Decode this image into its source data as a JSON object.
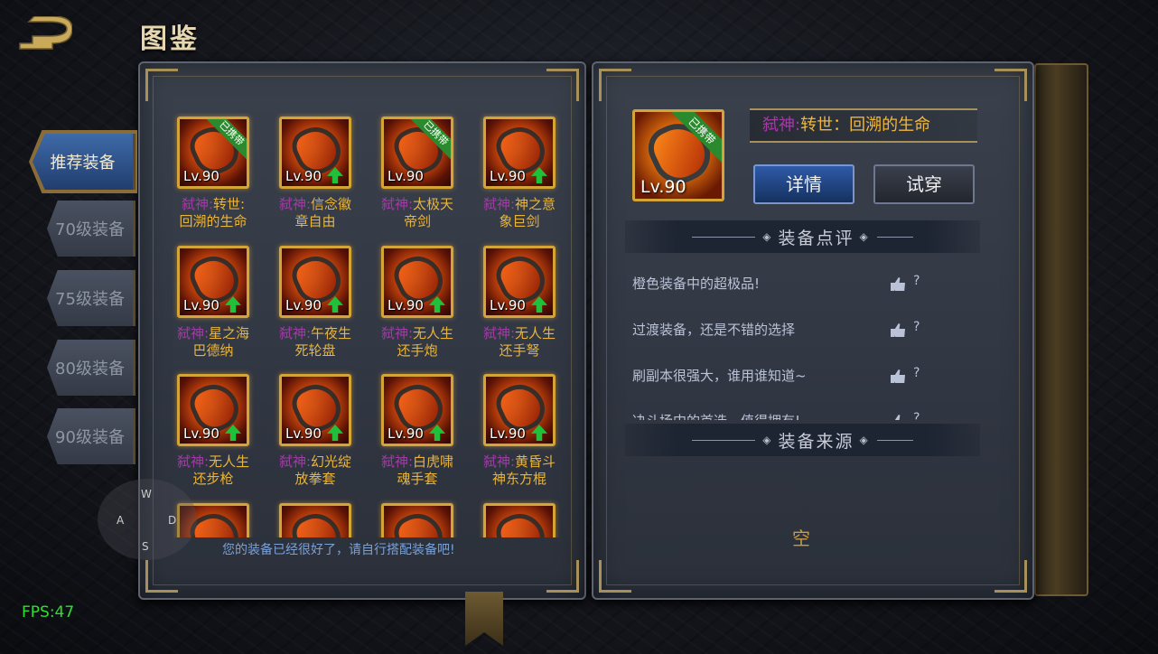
{
  "header": {
    "title": "图鉴"
  },
  "tabs": [
    {
      "label": "推荐装备",
      "active": true
    },
    {
      "label": "70级装备",
      "active": false
    },
    {
      "label": "75级装备",
      "active": false
    },
    {
      "label": "80级装备",
      "active": false
    },
    {
      "label": "90级装备",
      "active": false
    }
  ],
  "items": [
    {
      "prefix": "弑神:",
      "name1": "转世:",
      "name2": "回溯的生命",
      "lv": "Lv.90",
      "equipped": true,
      "upgrade": false
    },
    {
      "prefix": "弑神:",
      "name1": "信念徽",
      "name2": "章自由",
      "lv": "Lv.90",
      "equipped": false,
      "upgrade": true
    },
    {
      "prefix": "弑神:",
      "name1": "太极天",
      "name2": "帝剑",
      "lv": "Lv.90",
      "equipped": true,
      "upgrade": false
    },
    {
      "prefix": "弑神:",
      "name1": "神之意",
      "name2": "象巨剑",
      "lv": "Lv.90",
      "equipped": false,
      "upgrade": true
    },
    {
      "prefix": "弑神:",
      "name1": "星之海",
      "name2": "巴德纳",
      "lv": "Lv.90",
      "equipped": false,
      "upgrade": true
    },
    {
      "prefix": "弑神:",
      "name1": "午夜生",
      "name2": "死轮盘",
      "lv": "Lv.90",
      "equipped": false,
      "upgrade": true
    },
    {
      "prefix": "弑神:",
      "name1": "无人生",
      "name2": "还手炮",
      "lv": "Lv.90",
      "equipped": false,
      "upgrade": true
    },
    {
      "prefix": "弑神:",
      "name1": "无人生",
      "name2": "还手弩",
      "lv": "Lv.90",
      "equipped": false,
      "upgrade": true
    },
    {
      "prefix": "弑神:",
      "name1": "无人生",
      "name2": "还步枪",
      "lv": "Lv.90",
      "equipped": false,
      "upgrade": true
    },
    {
      "prefix": "弑神:",
      "name1": "幻光绽",
      "name2": "放拳套",
      "lv": "Lv.90",
      "equipped": false,
      "upgrade": true
    },
    {
      "prefix": "弑神:",
      "name1": "白虎啸",
      "name2": "魂手套",
      "lv": "Lv.90",
      "equipped": false,
      "upgrade": true
    },
    {
      "prefix": "弑神:",
      "name1": "黄昏斗",
      "name2": "神东方棍",
      "lv": "Lv.90",
      "equipped": false,
      "upgrade": true
    },
    {
      "prefix": "",
      "name1": "",
      "name2": "",
      "lv": "",
      "equipped": false,
      "upgrade": false
    },
    {
      "prefix": "",
      "name1": "",
      "name2": "",
      "lv": "",
      "equipped": false,
      "upgrade": false
    },
    {
      "prefix": "",
      "name1": "",
      "name2": "",
      "lv": "",
      "equipped": false,
      "upgrade": false
    },
    {
      "prefix": "",
      "name1": "",
      "name2": "",
      "lv": "",
      "equipped": false,
      "upgrade": false
    }
  ],
  "equipped_badge": "已携带",
  "bottom_hint": "您的装备已经很好了，请自行搭配装备吧!",
  "selected": {
    "prefix": "弑神:",
    "name": "转世：回溯的生命",
    "lv": "Lv.90",
    "badge": "已携带"
  },
  "buttons": {
    "detail": "详情",
    "try_on": "试穿"
  },
  "review_section": {
    "title": "装备点评",
    "items": [
      {
        "text": "橙色装备中的超极品!",
        "q": "?"
      },
      {
        "text": "过渡装备，还是不错的选择",
        "q": "?"
      },
      {
        "text": "刷副本很强大，谁用谁知道~",
        "q": "?"
      },
      {
        "text": "决斗场中的首选，值得拥有!",
        "q": "?"
      }
    ]
  },
  "source_section": {
    "title": "装备来源",
    "empty": "空"
  },
  "wasd": {
    "w": "W",
    "a": "A",
    "s": "S",
    "d": "D"
  },
  "fps": "FPS:47"
}
